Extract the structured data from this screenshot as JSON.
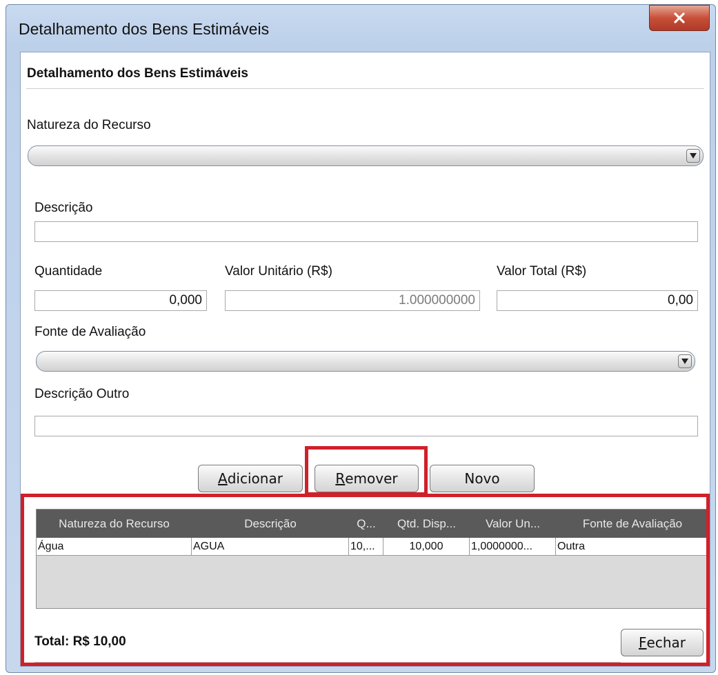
{
  "window": {
    "title": "Detalhamento dos Bens Estimáveis",
    "close_icon": "close-x-icon"
  },
  "form": {
    "heading": "Detalhamento dos Bens Estimáveis",
    "natureza_label": "Natureza do Recurso",
    "natureza_value": "",
    "descricao_label": "Descrição",
    "descricao_value": "",
    "quantidade_label": "Quantidade",
    "quantidade_value": "0,000",
    "valor_unitario_label": "Valor Unitário (R$)",
    "valor_unitario_value": "1.000000000",
    "valor_total_label": "Valor Total (R$)",
    "valor_total_value": "0,00",
    "fonte_label": "Fonte de Avaliação",
    "fonte_value": "",
    "descricao_outro_label": "Descrição Outro",
    "descricao_outro_value": ""
  },
  "buttons": {
    "adicionar": {
      "mnemonic": "A",
      "rest": "dicionar"
    },
    "remover": {
      "mnemonic": "R",
      "rest": "emover"
    },
    "novo": "Novo",
    "fechar": {
      "mnemonic": "F",
      "rest": "echar"
    }
  },
  "table": {
    "columns": [
      "Natureza do Recurso",
      "Descrição",
      "Q...",
      "Qtd. Disp...",
      "Valor Un...",
      "Fonte de Avaliação"
    ],
    "rows": [
      [
        "Água",
        "AGUA",
        "10,...",
        "10,000",
        "1,0000000...",
        "Outra"
      ]
    ]
  },
  "footer": {
    "total": "Total: R$  10,00"
  },
  "colors": {
    "highlight": "#d0202a",
    "close_button": "#c8503a",
    "grid_header": "#5a5a5a"
  }
}
